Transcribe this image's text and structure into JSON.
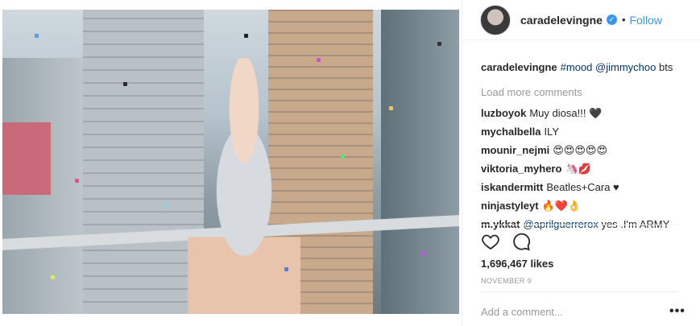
{
  "post": {
    "author": "caradelevingne",
    "follow_label": "Follow",
    "dot": "•",
    "verified_mark": "✓",
    "caption": {
      "user": "caradelevingne",
      "hashtag": "#mood",
      "mention": "@jimmychoo",
      "rest": "bts"
    },
    "load_more": "Load more comments",
    "comments": [
      {
        "user": "luzboyok",
        "text": "Muy diosa!!! 🖤"
      },
      {
        "user": "mychalbella",
        "text": "ILY"
      },
      {
        "user": "mounir_nejmi",
        "text": "😍😍😍😍😍"
      },
      {
        "user": "viktoria_myhero",
        "text": "🦄💋"
      },
      {
        "user": "iskandermitt",
        "text": "Beatles+Cara ♥"
      },
      {
        "user": "ninjastyleyt",
        "text": "🔥❤️👌"
      },
      {
        "user": "m.ykkat",
        "mention": "@aprilguerrerox",
        "text": "yes .I'm ARMY"
      }
    ],
    "likes": "1,696,467 likes",
    "date": "November 9",
    "add_comment_placeholder": "Add a comment...",
    "more_label": "•••",
    "icons": {
      "like": "heart-icon",
      "comment": "comment-icon",
      "verified": "verified-badge-icon"
    },
    "colors": {
      "link": "#3897f0",
      "mention": "#003569",
      "muted": "#999999"
    }
  }
}
